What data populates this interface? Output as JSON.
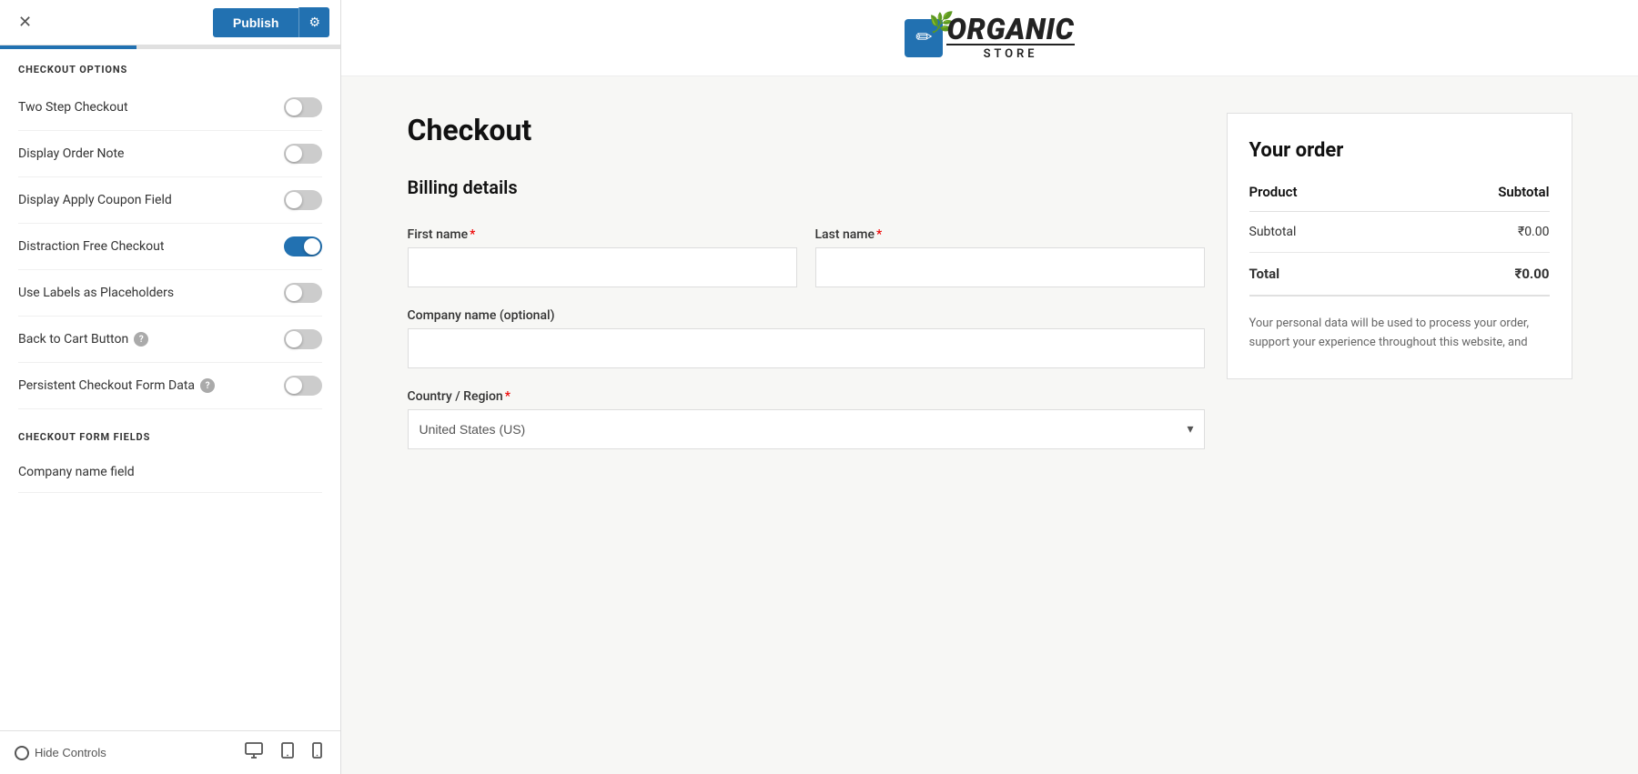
{
  "topbar": {
    "close_label": "✕",
    "publish_label": "Publish",
    "settings_icon": "⚙"
  },
  "sidebar": {
    "checkout_options_header": "CHECKOUT OPTIONS",
    "checkout_form_fields_header": "CHECKOUT FORM FIELDS",
    "options": [
      {
        "id": "two-step-checkout",
        "label": "Two Step Checkout",
        "checked": false,
        "has_help": false
      },
      {
        "id": "display-order-note",
        "label": "Display Order Note",
        "checked": false,
        "has_help": false
      },
      {
        "id": "display-apply-coupon",
        "label": "Display Apply Coupon Field",
        "checked": false,
        "has_help": false
      },
      {
        "id": "distraction-free",
        "label": "Distraction Free Checkout",
        "checked": true,
        "has_help": false
      },
      {
        "id": "use-labels-placeholders",
        "label": "Use Labels as Placeholders",
        "checked": false,
        "has_help": false
      },
      {
        "id": "back-to-cart",
        "label": "Back to Cart Button",
        "checked": false,
        "has_help": true
      },
      {
        "id": "persistent-checkout",
        "label": "Persistent Checkout Form Data",
        "checked": false,
        "has_help": true
      }
    ],
    "form_fields": [
      {
        "id": "company-name-field",
        "label": "Company name field"
      }
    ],
    "hide_controls_label": "Hide Controls"
  },
  "store": {
    "name_part1": "Organic",
    "name_part2": "Store",
    "logo_icon": "✏"
  },
  "checkout": {
    "title": "Checkout",
    "billing_title": "Billing details",
    "fields": {
      "first_name_label": "First name",
      "last_name_label": "Last name",
      "company_label": "Company name (optional)",
      "country_label": "Country / Region",
      "country_value": "United States (US)"
    }
  },
  "order": {
    "title": "Your order",
    "product_col": "Product",
    "subtotal_col": "Subtotal",
    "subtotal_label": "Subtotal",
    "subtotal_value": "₹0.00",
    "total_label": "Total",
    "total_value": "₹0.00",
    "privacy_text": "Your personal data will be used to process your order, support your experience throughout this website, and"
  },
  "devices": {
    "desktop_icon": "🖥",
    "tablet_icon": "⬜",
    "mobile_icon": "📱"
  }
}
